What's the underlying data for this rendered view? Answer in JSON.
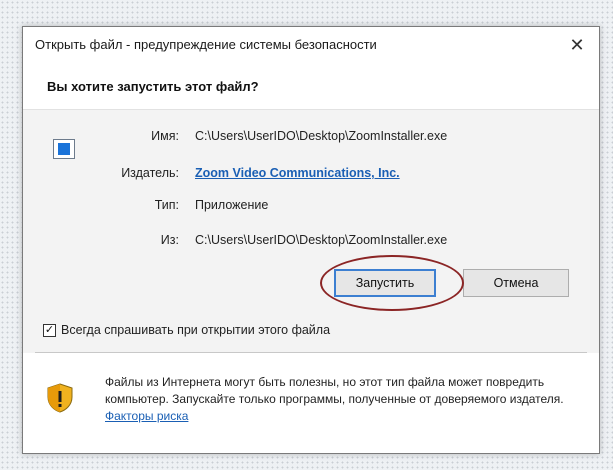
{
  "window": {
    "title": "Открыть файл - предупреждение системы безопасности",
    "close_glyph": "✕"
  },
  "header": {
    "question": "Вы хотите запустить этот файл?"
  },
  "file_info": {
    "icon": "application-icon",
    "name_label": "Имя:",
    "name_value": "C:\\Users\\UserIDO\\Desktop\\ZoomInstaller.exe",
    "publisher_label": "Издатель:",
    "publisher_value": "Zoom Video Communications, Inc.",
    "type_label": "Тип:",
    "type_value": "Приложение",
    "from_label": "Из:",
    "from_value": "C:\\Users\\UserIDO\\Desktop\\ZoomInstaller.exe"
  },
  "buttons": {
    "run_label": "Запустить",
    "cancel_label": "Отмена"
  },
  "checkbox": {
    "checked": true,
    "check_glyph": "✓",
    "label": "Всегда спрашивать при открытии этого файла"
  },
  "warning": {
    "icon": "security-shield-warning-icon",
    "text": "Файлы из Интернета могут быть полезны, но этот тип файла может повредить компьютер. Запускайте только программы, полученные от доверяемого издателя.",
    "link_text": "Факторы риска"
  },
  "colors": {
    "link": "#1a5fb4",
    "highlight_ellipse": "#8b2525",
    "primary_button_border": "#3c7fd1"
  }
}
